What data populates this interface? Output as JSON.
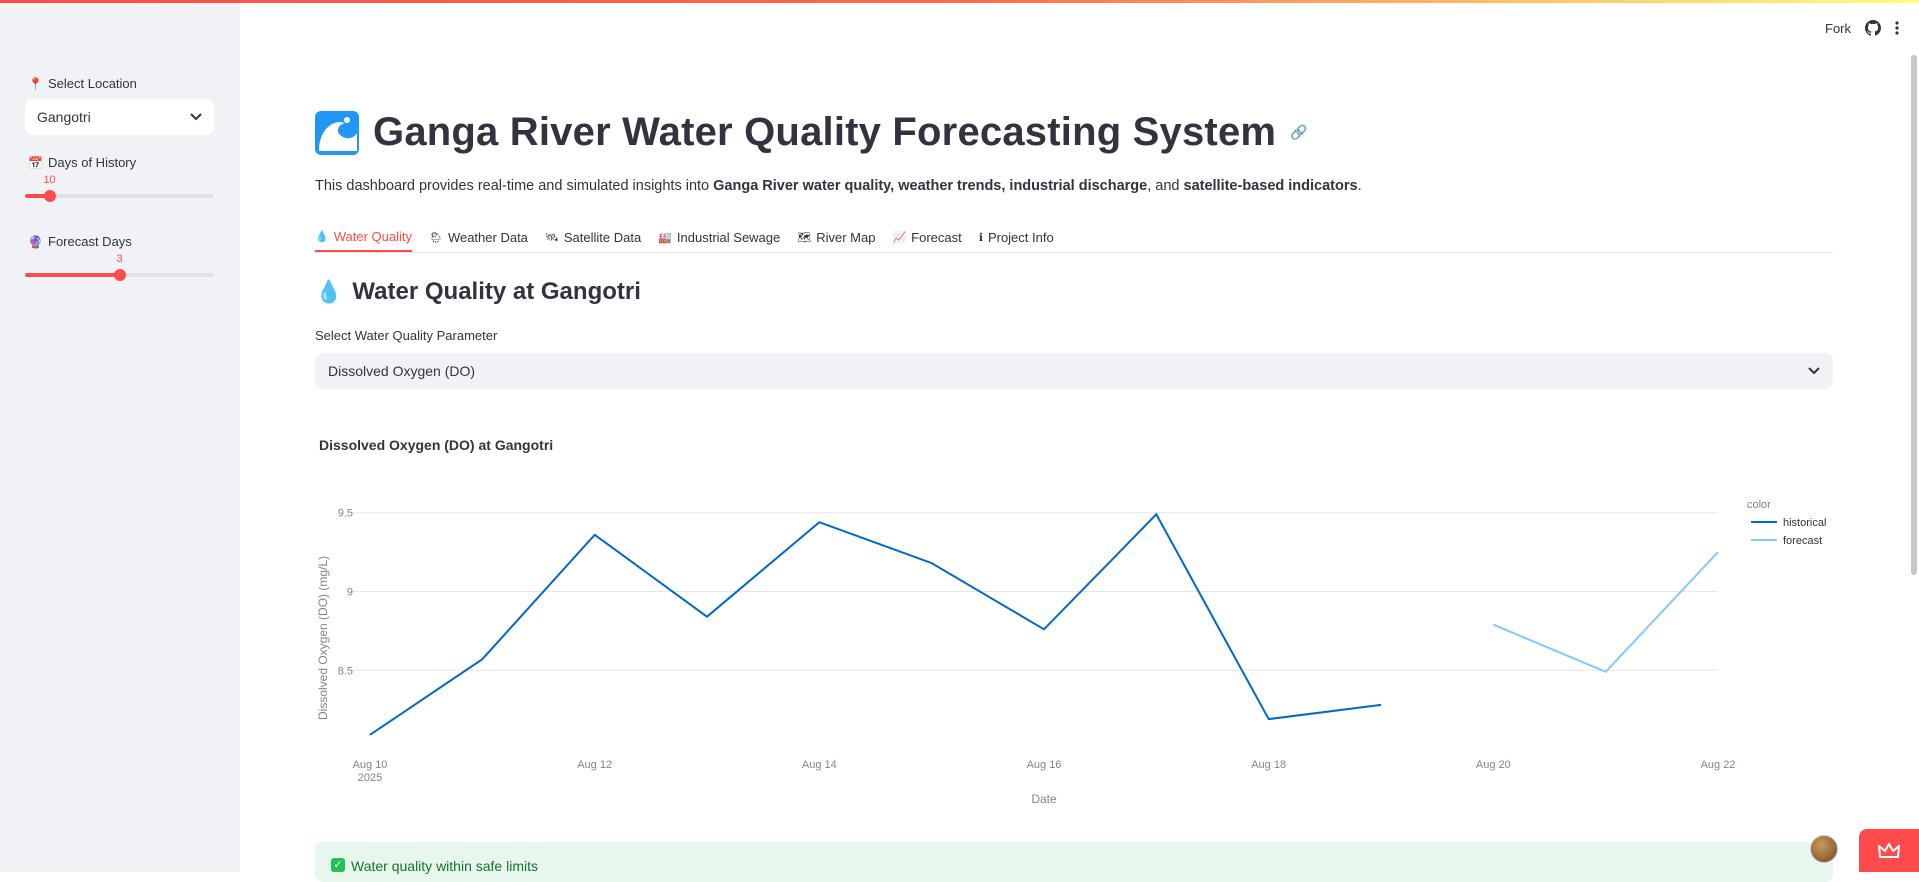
{
  "sidebar": {
    "location_label": "Select Location",
    "location_value": "Gangotri",
    "history_label": "Days of History",
    "history_value": "10",
    "history_fraction": 0.13,
    "forecast_label": "Forecast Days",
    "forecast_value": "3",
    "forecast_fraction": 0.5
  },
  "header": {
    "fork_label": "Fork"
  },
  "main": {
    "title": "Ganga River Water Quality Forecasting System",
    "desc_prefix": "This dashboard provides real-time and simulated insights into ",
    "desc_b1": "Ganga River water quality, weather trends, industrial discharge",
    "desc_mid": ", and ",
    "desc_b2": "satellite-based indicators",
    "desc_end": ".",
    "tabs": [
      {
        "label": "Water Quality",
        "icon": "💧"
      },
      {
        "label": "Weather Data",
        "icon": "🌦"
      },
      {
        "label": "Satellite Data",
        "icon": "🛰"
      },
      {
        "label": "Industrial Sewage",
        "icon": "🏭"
      },
      {
        "label": "River Map",
        "icon": "🗺"
      },
      {
        "label": "Forecast",
        "icon": "📈"
      },
      {
        "label": "Project Info",
        "icon": "ℹ"
      }
    ],
    "section_title": "Water Quality at Gangotri",
    "param_label": "Select Water Quality Parameter",
    "param_value": "Dissolved Oxygen (DO)",
    "success_text": "Water quality within safe limits"
  },
  "chart_data": {
    "type": "line",
    "title": "Dissolved Oxygen (DO) at Gangotri",
    "xlabel": "Date",
    "ylabel": "Dissolved Oxygen (DO) (mg/L)",
    "ylim": [
      8.07,
      9.53
    ],
    "yticks": [
      8.5,
      9,
      9.5
    ],
    "ytick_labels": [
      "8.5",
      "9",
      "9.5"
    ],
    "xlim": [
      0,
      12
    ],
    "xticks": [
      {
        "x": 0,
        "label": "Aug 10",
        "sub": "2025"
      },
      {
        "x": 2,
        "label": "Aug 12"
      },
      {
        "x": 4,
        "label": "Aug 14"
      },
      {
        "x": 6,
        "label": "Aug 16"
      },
      {
        "x": 8,
        "label": "Aug 18"
      },
      {
        "x": 10,
        "label": "Aug 20"
      },
      {
        "x": 12,
        "label": "Aug 22"
      }
    ],
    "legend_title": "color",
    "legend_placement": "right",
    "series": [
      {
        "name": "historical",
        "color": "#0068c9",
        "points": [
          [
            0,
            8.09
          ],
          [
            1,
            8.57
          ],
          [
            2,
            9.36
          ],
          [
            3,
            8.84
          ],
          [
            4,
            9.44
          ],
          [
            5,
            9.18
          ],
          [
            6,
            8.76
          ],
          [
            7,
            9.49
          ],
          [
            8,
            8.19
          ],
          [
            9,
            8.28
          ]
        ]
      },
      {
        "name": "forecast",
        "color": "#83c9ff",
        "points": [
          [
            10,
            8.79
          ],
          [
            11,
            8.49
          ],
          [
            12,
            9.25
          ]
        ]
      }
    ]
  }
}
